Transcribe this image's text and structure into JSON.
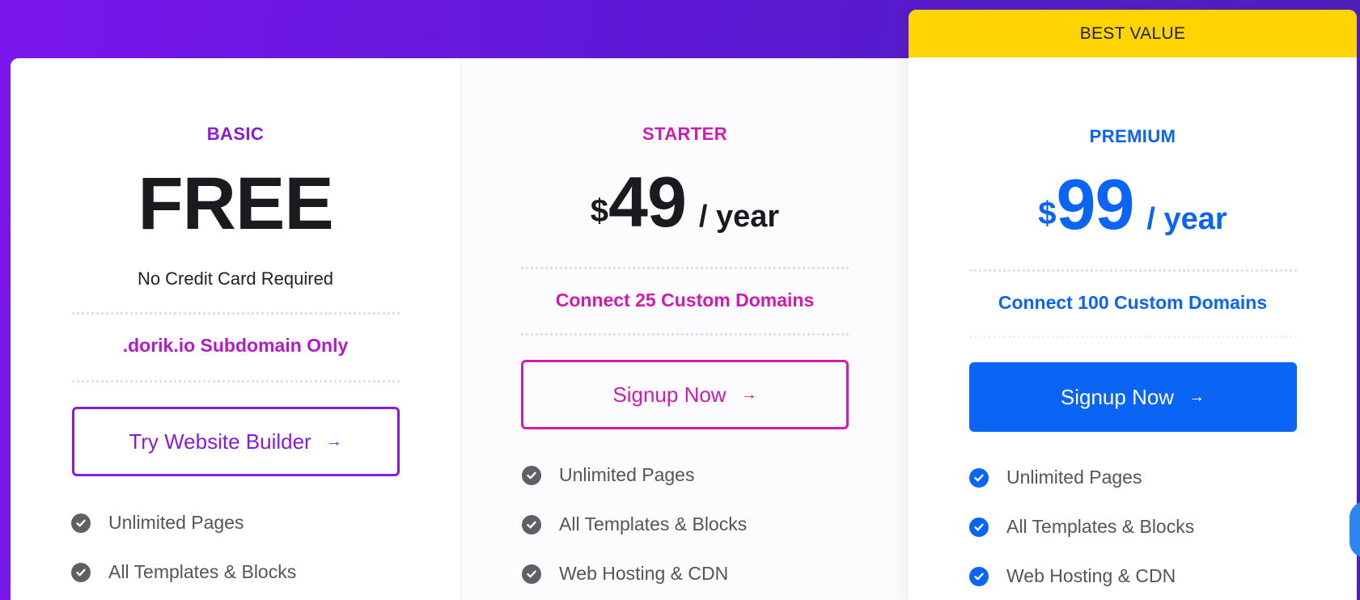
{
  "colors": {
    "basic_accent": "#8a1bd8",
    "starter_accent": "#d01bb0",
    "premium_accent": "#0a65f5",
    "ribbon": "#ffd400",
    "check_gray": "#5f5f66"
  },
  "plans": {
    "basic": {
      "name": "BASIC",
      "price": "FREE",
      "note": "No Credit Card Required",
      "domains": ".dorik.io Subdomain Only",
      "button_label": "Try Website Builder",
      "button_icon": "arrow-right-icon",
      "features": [
        "Unlimited Pages",
        "All Templates & Blocks"
      ]
    },
    "starter": {
      "name": "STARTER",
      "currency": "$",
      "amount": "49",
      "period": "/ year",
      "domains": "Connect 25 Custom Domains",
      "button_label": "Signup Now",
      "button_icon": "arrow-right-icon",
      "features": [
        "Unlimited Pages",
        "All Templates & Blocks",
        "Web Hosting & CDN"
      ]
    },
    "premium": {
      "ribbon": "BEST VALUE",
      "name": "PREMIUM",
      "currency": "$",
      "amount": "99",
      "period": "/ year",
      "domains": "Connect 100 Custom Domains",
      "button_label": "Signup Now",
      "button_icon": "arrow-right-icon",
      "features": [
        "Unlimited Pages",
        "All Templates & Blocks",
        "Web Hosting & CDN"
      ]
    }
  }
}
